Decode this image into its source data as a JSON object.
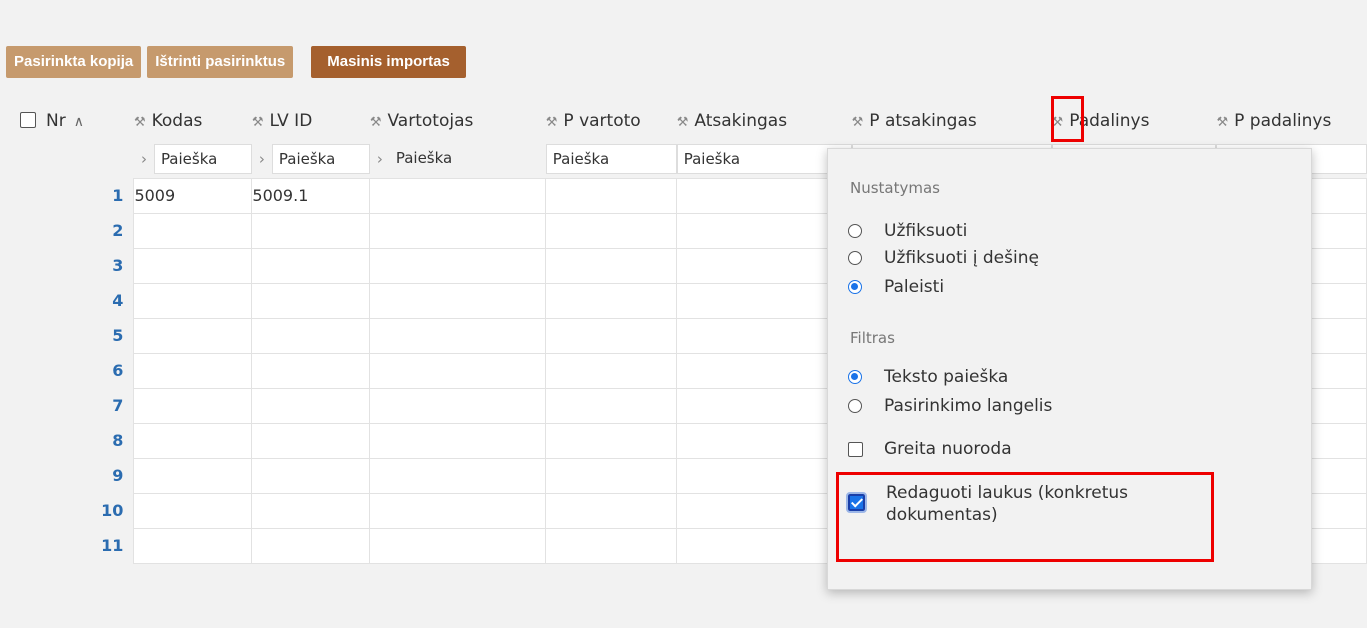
{
  "toolbar": {
    "copy_label": "Pasirinkta kopija",
    "delete_label": "Ištrinti pasirinktus",
    "import_label": "Masinis importas"
  },
  "columns": [
    {
      "label": "Nr",
      "filter": null
    },
    {
      "label": "Kodas",
      "filter": "Paieška"
    },
    {
      "label": "LV ID",
      "filter": "Paieška"
    },
    {
      "label": "Vartotojas",
      "filter": "Paieška"
    },
    {
      "label": "P vartoto",
      "filter": "Paieška"
    },
    {
      "label": "Atsakingas",
      "filter": "Paieška"
    },
    {
      "label": "P atsakingas",
      "filter": ""
    },
    {
      "label": "Padalinys",
      "filter": ""
    },
    {
      "label": "P padalinys",
      "filter": ""
    }
  ],
  "rows": [
    {
      "nr": "1",
      "kodas": "5009",
      "lvid": "5009.1"
    },
    {
      "nr": "2",
      "kodas": "",
      "lvid": ""
    },
    {
      "nr": "3",
      "kodas": "",
      "lvid": ""
    },
    {
      "nr": "4",
      "kodas": "",
      "lvid": ""
    },
    {
      "nr": "5",
      "kodas": "",
      "lvid": ""
    },
    {
      "nr": "6",
      "kodas": "",
      "lvid": ""
    },
    {
      "nr": "7",
      "kodas": "",
      "lvid": ""
    },
    {
      "nr": "8",
      "kodas": "",
      "lvid": ""
    },
    {
      "nr": "9",
      "kodas": "",
      "lvid": ""
    },
    {
      "nr": "10",
      "kodas": "",
      "lvid": ""
    },
    {
      "nr": "11",
      "kodas": "",
      "lvid": ""
    }
  ],
  "dropdown": {
    "section_setting": "Nustatymas",
    "opt_pin": "Užfiksuoti",
    "opt_pin_right": "Užfiksuoti į dešinę",
    "opt_release": "Paleisti",
    "section_filter": "Filtras",
    "opt_text_search": "Teksto paieška",
    "opt_select_box": "Pasirinkimo langelis",
    "opt_quick_link": "Greita nuoroda",
    "opt_edit_fields_line1": "Redaguoti laukus (konkretus",
    "opt_edit_fields_line2": "dokumentas)"
  },
  "colors": {
    "button_light": "#c69a6d",
    "button_dark": "#a5602e",
    "row_number": "#2b6cb0",
    "highlight": "#e00000",
    "accent": "#1a73e8"
  }
}
